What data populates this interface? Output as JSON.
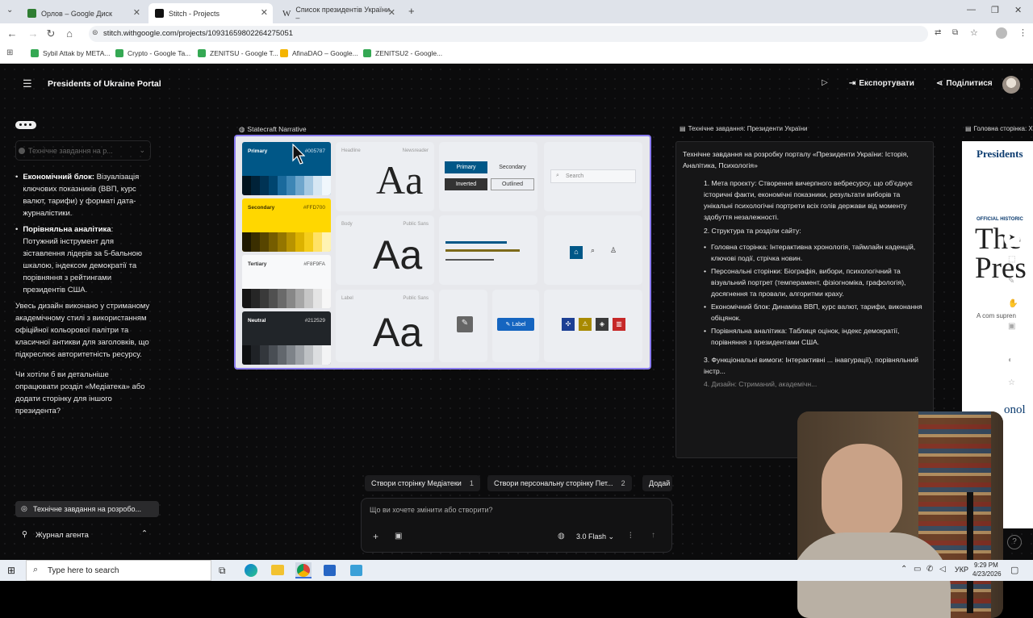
{
  "browser": {
    "tabs": [
      {
        "title": "Орлов – Google Диск",
        "active": false
      },
      {
        "title": "Stitch - Projects",
        "active": true
      },
      {
        "title": "Список президентів України –",
        "active": false
      }
    ],
    "url": "stitch.withgoogle.com/projects/10931659802264275051",
    "bookmarks": [
      "Sybil Attak by META...",
      "Crypto - Google Ta...",
      "ZENITSU - Google T...",
      "AfinaDAO – Google...",
      "ZENITSU2 - Google..."
    ]
  },
  "app": {
    "project_title": "Presidents of Ukraine Portal",
    "export_label": "Експортувати",
    "share_label": "Поділитися",
    "left_panel": {
      "task_dropdown": "Технічне завдання на р...",
      "bullet1_head": "Економічний блок:",
      "bullet1_body": "Візуалізація ключових показників (ВВП, курс валют, тарифи) у форматі дата-журналістики.",
      "bullet2_head": "Порівняльна аналітика",
      "bullet2_body": "Потужний інструмент для зіставлення лідерів за 5-бальною шкалою, індексом демократії та порівняння з рейтингами президентів США.",
      "para1": "Увесь дизайн виконано у стриманому академічному стилі з використанням офіційної кольорової палітри та класичної антикви для заголовків, що підкреслює авторитетність ресурсу.",
      "para2": "Чи хотіли б ви детальніше опрацювати розділ «Медіатека» або додати сторінку для іншого президента?",
      "task_button": "Технічне завдання на розробо...",
      "agent_log": "Журнал агента"
    },
    "board": {
      "title": "Statecraft Narrative",
      "swatches": [
        {
          "name": "Primary",
          "hex": "#005787"
        },
        {
          "name": "Secondary",
          "hex": "#FFD700"
        },
        {
          "name": "Tertiary",
          "hex": "#F8F9FA"
        },
        {
          "name": "Neutral",
          "hex": "#212529"
        }
      ],
      "type_samples": [
        {
          "label": "Headline",
          "font": "Newsreader",
          "sample": "Aa"
        },
        {
          "label": "Body",
          "font": "Public Sans",
          "sample": "Aa"
        },
        {
          "label": "Label",
          "font": "Public Sans",
          "sample": "Aa"
        }
      ],
      "buttons": {
        "primary": "Primary",
        "secondary": "Secondary",
        "inverted": "Inverted",
        "outlined": "Outlined"
      },
      "search_placeholder": "Search",
      "label_chip": "Label"
    },
    "spec": {
      "header": "Технічне завдання: Президенти України",
      "title": "Технічне завдання на розробку порталу «Президенти України: Історія, Аналітика, Психологія»",
      "item1": "1. Мета проєкту: Створення вичерпного вебресурсу, що об'єднує історичні факти, економічні показники, результати виборів та унікальні психологічні портрети всіх голів держави від моменту здобуття незалежності.",
      "item2": "2. Структура та розділи сайту:",
      "sub1": "Головна сторінка: Інтерактивна хронологія, таймлайн каденцій, ключові події, стрічка новин.",
      "sub2": "Персональні сторінки: Біографія, вибори, психологічний та візуальний портрет (темперамент, фізіогноміка, графологія), досягнення та провали, алгоритми краху.",
      "sub3": "Економічний блок: Динаміка ВВП, курс валют, тарифи, виконання обіцянок.",
      "sub4": "Порівняльна аналітика: Таблиця оцінок, індекс демократії, порівняння з президентами США.",
      "item3": "3. Функціональні вимоги: Інтерактивні ... інавгурації), порівняльний інстр...",
      "item4": "4. Дизайн: Стриманий, академічн..."
    },
    "preview": {
      "header": "Головна сторінка: Хр",
      "brand": "Presidents",
      "kicker": "OFFICIAL HISTORIC",
      "big": "The Pres",
      "sub": "A com supren",
      "footer": "onol"
    },
    "chips": [
      {
        "label": "Створи сторінку Медіатеки",
        "count": "1"
      },
      {
        "label": "Створи персональну сторінку Пет...",
        "count": "2"
      },
      {
        "label": "Додай",
        "count": ""
      }
    ],
    "prompt": {
      "placeholder": "Що ви хочете змінити або створити?",
      "model": "3.0 Flash"
    }
  },
  "taskbar": {
    "search_placeholder": "Type here to search",
    "lang": "УКР",
    "time": "9:29 PM",
    "date": "4/23/2026"
  },
  "colors": {
    "accent": "#8a7cf0",
    "primary": "#005787",
    "secondary": "#FFD700"
  }
}
